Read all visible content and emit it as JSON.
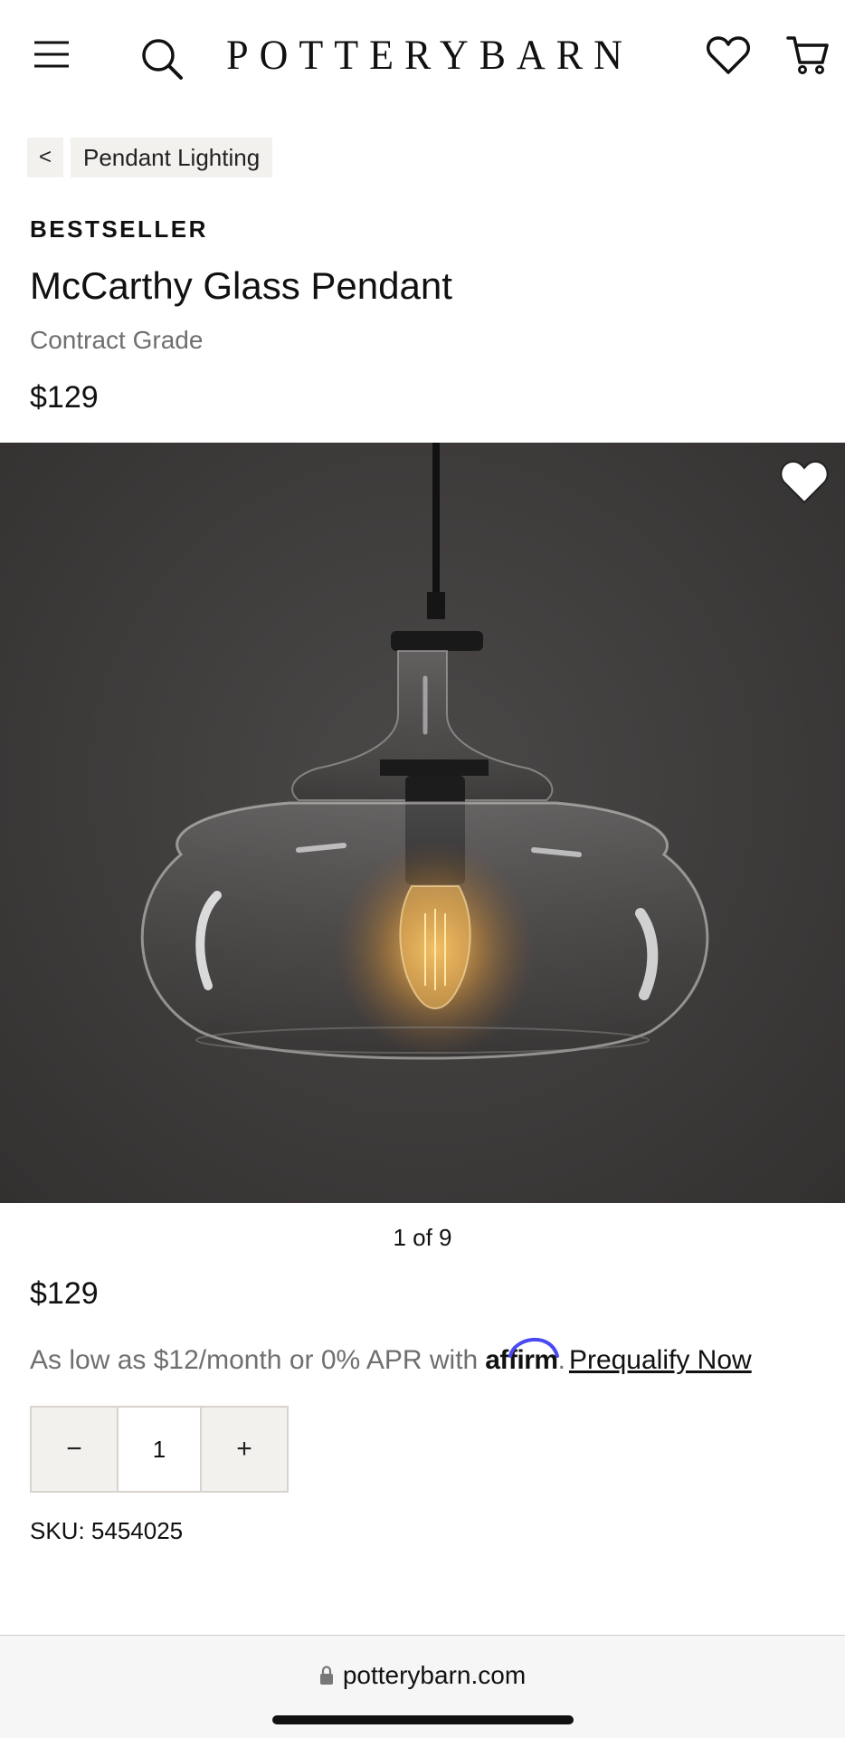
{
  "header": {
    "logo": "POTTERYBARN",
    "icons": [
      "menu-icon",
      "search-icon",
      "heart-icon",
      "cart-icon"
    ]
  },
  "breadcrumb": {
    "back_label": "<",
    "category": "Pendant Lighting"
  },
  "product": {
    "badge": "BESTSELLER",
    "name": "McCarthy Glass Pendant",
    "subtitle": "Contract Grade",
    "price": "$129",
    "image_counter": "1 of 9",
    "price_repeat": "$129"
  },
  "financing": {
    "text": "As low as $12/month or 0% APR with",
    "brand": "affirm",
    "separator": ".",
    "link": "Prequalify Now"
  },
  "quantity": {
    "decrement": "−",
    "value": "1",
    "increment": "+"
  },
  "sku": "SKU: 5454025",
  "browser": {
    "url": "potterybarn.com"
  },
  "colors": {
    "affirm_arc": "#4a4af4",
    "image_bg": "#3e3b3b",
    "stepper_bg": "#f3f1ee"
  }
}
